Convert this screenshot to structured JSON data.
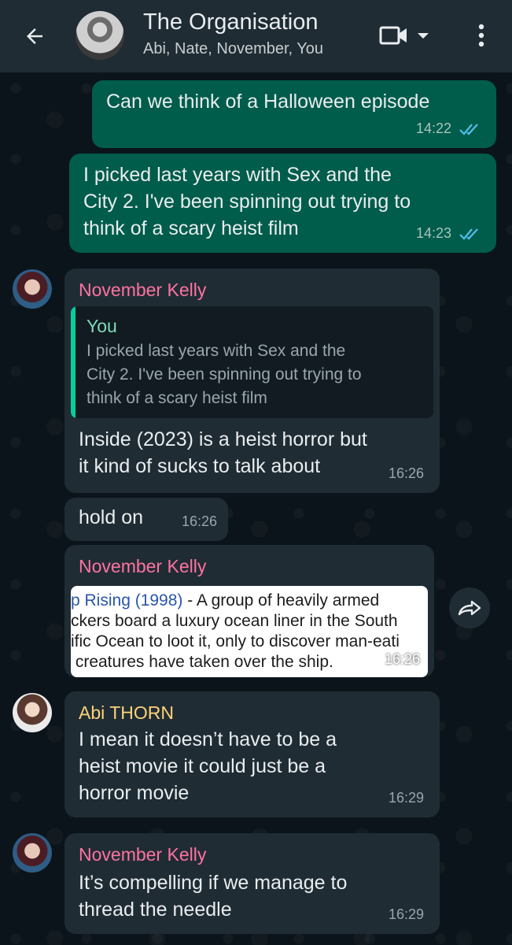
{
  "header": {
    "title": "The Organisation",
    "members": "Abi, Nate, November, You"
  },
  "messages": [
    {
      "text": "Can we think of a Halloween episode",
      "time": "14:22"
    },
    {
      "text": "I picked last years with Sex and the\nCity 2. I've been spinning out trying to\nthink of a scary heist film",
      "time": "14:23"
    },
    {
      "sender": "November Kelly",
      "quote": {
        "name": "You",
        "text": "I picked last years with Sex and the\nCity 2. I've been spinning out trying to\nthink of a scary heist film"
      },
      "text": "Inside (2023) is a heist horror but\nit kind of sucks to talk about",
      "time": "16:26"
    },
    {
      "text": "hold on",
      "time": "16:26"
    },
    {
      "sender": "November Kelly",
      "image": {
        "title": "p Rising (1998)",
        "line1": " - A group of heavily armed",
        "line2": "ckers board a luxury ocean liner in the South",
        "line3": "ific Ocean to loot it, only to discover man-eati",
        "line4": " creatures have taken over the ship."
      },
      "time": "16:26"
    },
    {
      "sender": "Abi THORN",
      "text": "I mean it doesn’t have to be a\nheist movie it could just be a\nhorror movie",
      "time": "16:29"
    },
    {
      "sender": "November Kelly",
      "text": "It’s compelling if we manage to\nthread the needle",
      "time": "16:29"
    }
  ],
  "colors": {
    "header_bg": "#1f2c34",
    "outgoing_bubble": "#005c4b",
    "incoming_bubble": "#1f2c34",
    "read_ticks": "#53bdeb",
    "sender_november": "#ff72a1",
    "sender_abi": "#ffd279"
  },
  "icons": [
    "back-arrow-icon",
    "video-call-icon",
    "dropdown-caret-icon",
    "more-vert-icon",
    "read-ticks-icon",
    "forward-icon"
  ]
}
